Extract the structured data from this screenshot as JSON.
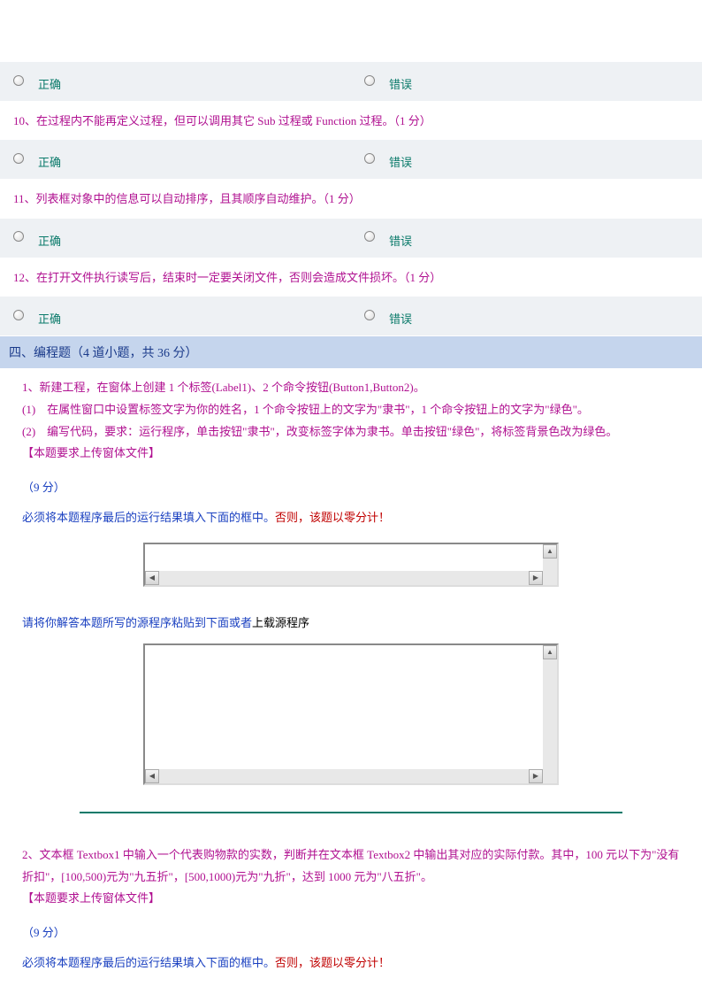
{
  "tf_questions": [
    {
      "true_label": "正确",
      "false_label": "错误"
    },
    {
      "prompt": "10、在过程内不能再定义过程，但可以调用其它 Sub 过程或 Function 过程。（1 分）",
      "true_label": "正确",
      "false_label": "错误"
    },
    {
      "prompt": "11、列表框对象中的信息可以自动排序，且其顺序自动维护。（1 分）",
      "true_label": "正确",
      "false_label": "错误"
    },
    {
      "prompt": "12、在打开文件执行读写后，结束时一定要关闭文件，否则会造成文件损坏。（1 分）",
      "true_label": "正确",
      "false_label": "错误"
    }
  ],
  "section4_header": "四、编程题（4 道小题，共 36 分）",
  "prog1": {
    "line1": "1、新建工程，在窗体上创建 1 个标签(Label1)、2 个命令按钮(Button1,Button2)。",
    "line2": "(1)　在属性窗口中设置标签文字为你的姓名，1 个命令按钮上的文字为\"隶书\"，1 个命令按钮上的文字为\"绿色\"。",
    "line3": "(2)　编写代码，要求：运行程序，单击按钮\"隶书\"，改变标签字体为隶书。单击按钮\"绿色\"，将标签背景色改为绿色。",
    "line4": "【本题要求上传窗体文件】",
    "score": "（9 分）",
    "instruction_prefix": "必须将本题程序最后的运行结果填入下面的框中。",
    "instruction_red": "否则，该题以零分计！",
    "paste_prefix": "请将你解答本题所写的源程序粘贴到下面或者",
    "paste_link": "上载源程序"
  },
  "prog2": {
    "line1": "2、文本框 Textbox1 中输入一个代表购物款的实数，判断并在文本框 Textbox2 中输出其对应的实际付款。其中，100 元以下为\"没有折扣\"，[100,500)元为\"九五折\"，[500,1000)元为\"九折\"，达到 1000 元为\"八五折\"。",
    "line2": "【本题要求上传窗体文件】",
    "score": "（9 分）",
    "instruction_prefix": "必须将本题程序最后的运行结果填入下面的框中。",
    "instruction_red": "否则，该题以零分计！"
  }
}
